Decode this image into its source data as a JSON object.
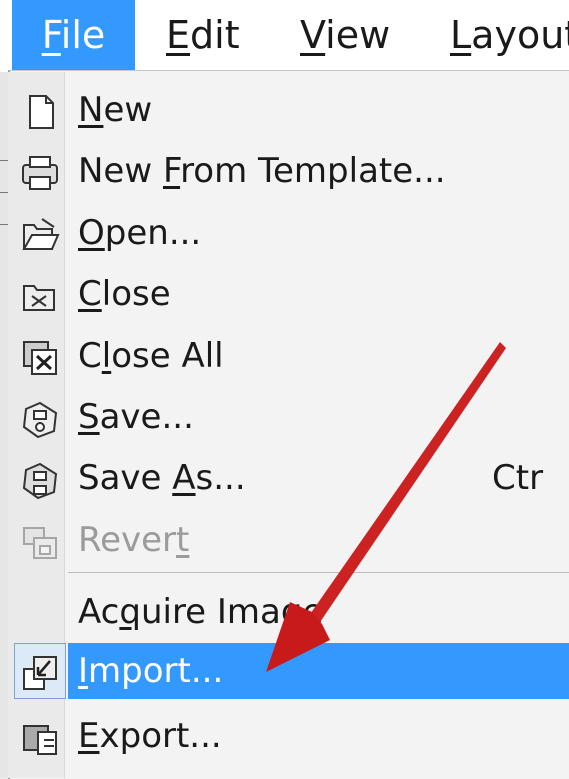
{
  "menubar": {
    "items": [
      {
        "label_u": "F",
        "label_rest": "ile"
      },
      {
        "label_u": "E",
        "label_rest": "dit"
      },
      {
        "label_u": "V",
        "label_rest": "iew"
      },
      {
        "label_u": "L",
        "label_rest": "ayout"
      }
    ]
  },
  "file_menu": {
    "items": [
      {
        "icon": "new-document-icon",
        "pre": "",
        "u": "N",
        "post": "ew",
        "shortcut": ""
      },
      {
        "icon": "template-icon",
        "pre": "New ",
        "u": "F",
        "post": "rom Template...",
        "shortcut": ""
      },
      {
        "icon": "open-folder-icon",
        "pre": "",
        "u": "O",
        "post": "pen...",
        "shortcut": ""
      },
      {
        "icon": "close-icon",
        "pre": "",
        "u": "C",
        "post": "lose",
        "shortcut": ""
      },
      {
        "icon": "close-all-icon",
        "pre": "C",
        "u": "l",
        "post": "ose All",
        "shortcut": ""
      },
      {
        "icon": "save-icon",
        "pre": "",
        "u": "S",
        "post": "ave...",
        "shortcut": ""
      },
      {
        "icon": "save-as-icon",
        "pre": "Save ",
        "u": "A",
        "post": "s...",
        "shortcut": "Ctr"
      },
      {
        "icon": "revert-icon",
        "pre": "Rever",
        "u": "t",
        "post": "",
        "shortcut": "",
        "disabled": true
      },
      {
        "icon": "",
        "pre": "Ac",
        "u": "q",
        "post": "uire Image",
        "shortcut": ""
      },
      {
        "icon": "import-icon",
        "pre": "",
        "u": "I",
        "post": "mport...",
        "shortcut": "",
        "highlighted": true
      },
      {
        "icon": "export-icon",
        "pre": "",
        "u": "E",
        "post": "xport...",
        "shortcut": ""
      }
    ]
  },
  "annotation": {
    "arrow_color": "#d62020"
  },
  "colors": {
    "highlight": "#3399ff",
    "disabled_text": "#9b9b9b"
  }
}
